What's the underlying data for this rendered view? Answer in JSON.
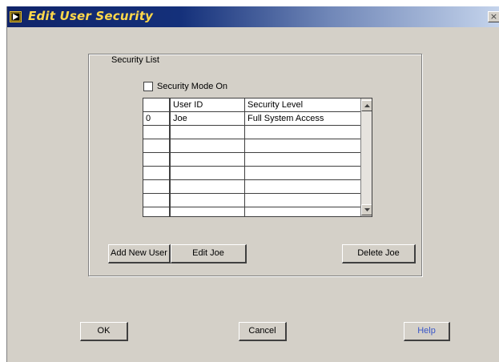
{
  "window": {
    "title": "Edit User Security",
    "close_glyph": "×",
    "app_icon": "play-arrow-icon",
    "close_icon": "close-icon"
  },
  "security_list": {
    "legend": "Security List",
    "security_mode_label": "Security Mode On",
    "security_mode_checked": false,
    "columns": [
      "",
      "User ID",
      "Security Level"
    ],
    "rows": [
      [
        "0",
        "Joe",
        "Full System Access"
      ],
      [
        "",
        "",
        ""
      ],
      [
        "",
        "",
        ""
      ],
      [
        "",
        "",
        ""
      ],
      [
        "",
        "",
        ""
      ],
      [
        "",
        "",
        ""
      ],
      [
        "",
        "",
        ""
      ],
      [
        "",
        "",
        ""
      ]
    ],
    "scroll_icons": [
      "scroll-up-icon",
      "scroll-down-icon"
    ]
  },
  "actions": {
    "add_new_user": "Add New User",
    "edit": "Edit Joe",
    "delete": "Delete Joe"
  },
  "dialog_buttons": {
    "ok": "OK",
    "cancel": "Cancel",
    "help": "Help"
  },
  "colors": {
    "title_text": "#ffd84a",
    "title_bar": "#10246a",
    "dialog_bg": "#d4d0c8",
    "help_text": "#3a57c8"
  }
}
